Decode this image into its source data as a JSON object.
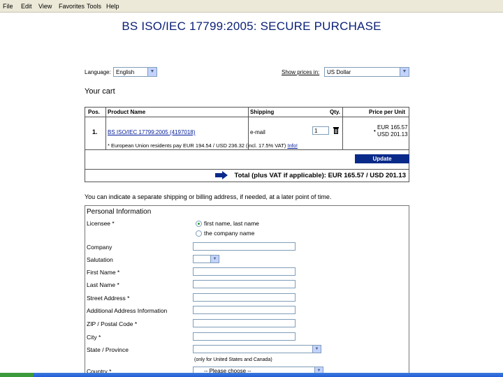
{
  "menubar": {
    "items": [
      "File",
      "Edit",
      "View",
      "Favorites",
      "Tools",
      "Help"
    ]
  },
  "page": {
    "title": "BS ISO/IEC 17799:2005: SECURE PURCHASE"
  },
  "language": {
    "label": "Language:",
    "value": "English"
  },
  "currency": {
    "label": "Show prices in:",
    "value": "US Dollar"
  },
  "cart": {
    "heading": "Your cart",
    "columns": {
      "pos": "Pos.",
      "product": "Product Name",
      "shipping": "Shipping",
      "qty": "Qty.",
      "price": "Price per Unit"
    },
    "item": {
      "pos": "1.",
      "product": "BS ISO/IEC 17799:2005 (4197018)",
      "shipping": "e-mail",
      "qty": "1",
      "price_eur": "EUR 165.57",
      "price_usd": "USD 201.13"
    },
    "note": "* European Union residents pay EUR 194.54 / USD 236.32 (incl. 17.5% VAT)",
    "info_link": "Info!",
    "update_label": "Update",
    "total": "Total (plus VAT if applicable): EUR 165.57 / USD 201.13"
  },
  "indicate_text": "You can indicate a separate shipping or billing address, if needed, at a later point of time.",
  "form": {
    "heading": "Personal Information",
    "licensee_label": "Licensee *",
    "licensee_options": [
      "first name, last name",
      "the company name"
    ],
    "company_label": "Company",
    "salutation_label": "Salutation",
    "firstname_label": "First Name *",
    "lastname_label": "Last Name *",
    "street_label": "Street Address *",
    "additional_label": "Additional Address Information",
    "zip_label": "ZIP / Postal Code *",
    "city_label": "City *",
    "state_label": "State / Province",
    "state_hint": "(only for United States and Canada)",
    "country_label": "Country *",
    "country_value": "-- Please choose --"
  },
  "colors": {
    "title": "#0a1f78",
    "button": "#0a2a8a",
    "link": "#001a99"
  }
}
